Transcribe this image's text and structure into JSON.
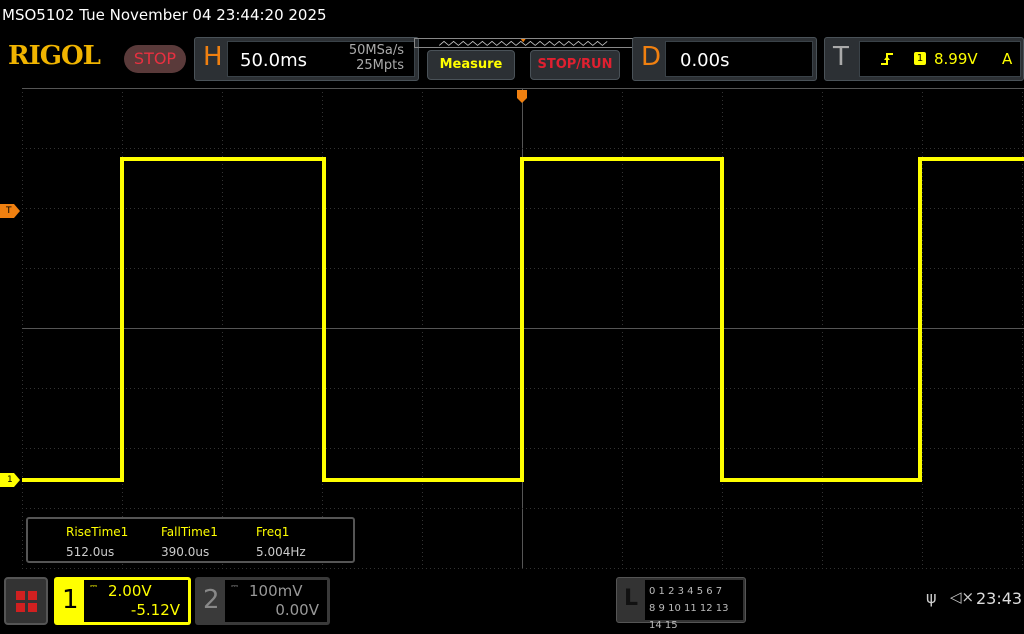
{
  "header": {
    "title": "MSO5102  Tue November 04 23:44:20 2025",
    "logo": "RIGOL",
    "run_state": "STOP"
  },
  "horizontal": {
    "letter": "H",
    "timebase": "50.0ms",
    "sample_rate": "50MSa/s",
    "memory_depth": "25Mpts"
  },
  "buttons": {
    "measure": "Measure",
    "stop_run": "STOP/RUN"
  },
  "delay": {
    "letter": "D",
    "value": "0.00s"
  },
  "trigger": {
    "letter": "T",
    "slope_icon": "rising-edge-icon",
    "source": "1",
    "level": "8.99V",
    "mode": "A",
    "marker": "T"
  },
  "channel_marker": "1",
  "waveform": {
    "color": "#ffff00",
    "scale_v_per_div": 2.0,
    "offset_v": -5.12,
    "high_v": 10.7,
    "low_v": 0.0,
    "time_per_div_ms": 50,
    "rising_edges_ms": [
      -200,
      0,
      199
    ],
    "falling_edges_ms": [
      -99,
      100
    ]
  },
  "measurements": [
    {
      "label": "RiseTime1",
      "value": "512.0us"
    },
    {
      "label": "FallTime1",
      "value": "390.0us"
    },
    {
      "label": "Freq1",
      "value": "5.004Hz"
    }
  ],
  "channels": [
    {
      "num": "1",
      "coupling_icon": "dc-coupling-icon",
      "scale": "2.00V",
      "offset": "-5.12V",
      "color": "#ffff00"
    },
    {
      "num": "2",
      "coupling_icon": "dc-coupling-icon",
      "scale": "100mV",
      "offset": "0.00V"
    }
  ],
  "logic": {
    "letter": "L",
    "row1": "0 1 2 3  4 5 6 7",
    "row2": "8 9 10 11 12 13 14 15"
  },
  "status": {
    "usb_icon": "usb-icon",
    "sound_icon": "mute-icon",
    "time": "23:43"
  }
}
